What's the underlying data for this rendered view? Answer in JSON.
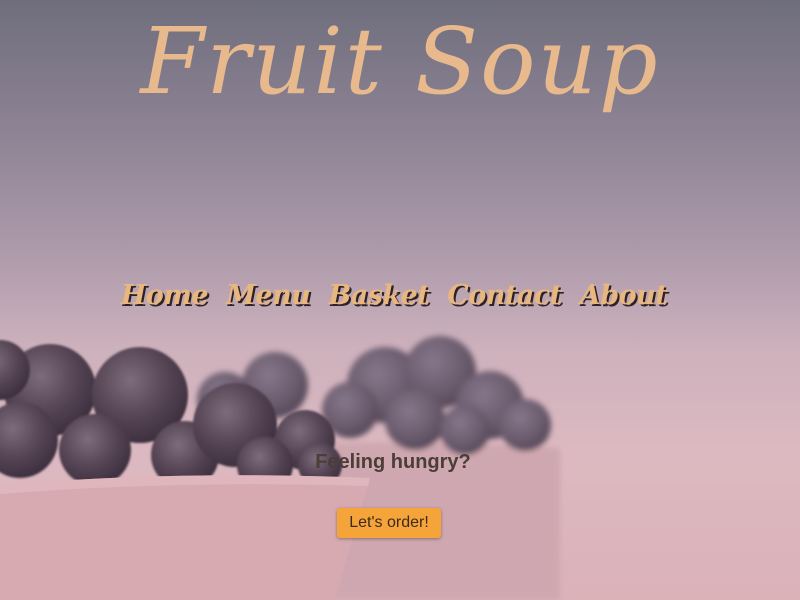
{
  "site": {
    "title": "Fruit Soup"
  },
  "nav": {
    "items": [
      {
        "label": "Home"
      },
      {
        "label": "Menu"
      },
      {
        "label": "Basket"
      },
      {
        "label": "Contact"
      },
      {
        "label": "About"
      }
    ]
  },
  "hero": {
    "tagline": "Feeling hungry?",
    "cta_label": "Let's order!"
  },
  "colors": {
    "title": "#e7b98d",
    "nav": "#e8b77f",
    "button": "#f5a43a",
    "tagline": "#4a3e37"
  }
}
